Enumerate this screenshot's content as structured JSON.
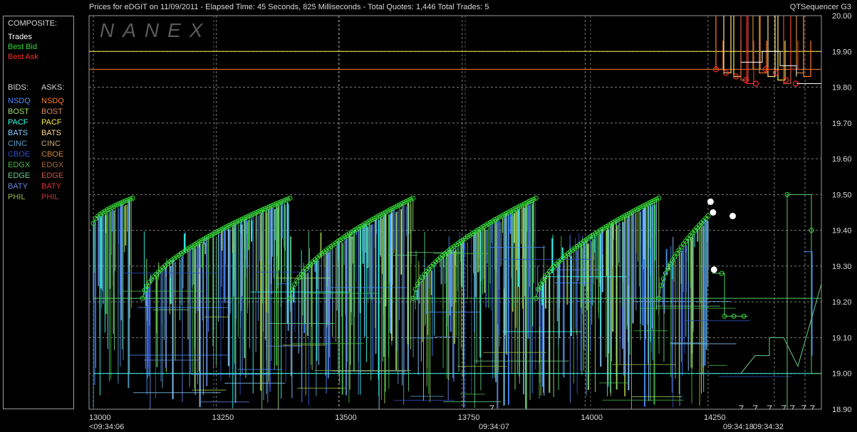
{
  "header": {
    "title": "Prices for  eDGIT  on  11/09/2011  -  Elapsed Time: 45 Seconds, 825 Milliseconds  -  Total Quotes: 1,446  Total Trades: 5",
    "app_name": "QTSequencer G3"
  },
  "watermark": "NANEX",
  "legend": {
    "composite_heading": "COMPOSITE:",
    "composite": [
      {
        "label": "Trades",
        "color": "#ffffff"
      },
      {
        "label": "Best Bid",
        "color": "#33dd33"
      },
      {
        "label": "Best Ask",
        "color": "#ff2a2a"
      }
    ],
    "bids_heading": "BIDS:",
    "asks_heading": "ASKS:",
    "bids": [
      {
        "label": "NSDQ",
        "color": "#4a8cff"
      },
      {
        "label": "BOST",
        "color": "#9fe06a"
      },
      {
        "label": "PACF",
        "color": "#33ffee"
      },
      {
        "label": "BATS",
        "color": "#88ccff"
      },
      {
        "label": "CINC",
        "color": "#5aa0c8"
      },
      {
        "label": "CBOE",
        "color": "#3050c0"
      },
      {
        "label": "EDGX",
        "color": "#44bb44"
      },
      {
        "label": "EDGE",
        "color": "#66cc88"
      },
      {
        "label": "BATY",
        "color": "#6688dd"
      },
      {
        "label": "PHIL",
        "color": "#99bb44"
      }
    ],
    "asks": [
      {
        "label": "NSDQ",
        "color": "#ff7a2a"
      },
      {
        "label": "BOST",
        "color": "#e08a5a"
      },
      {
        "label": "PACF",
        "color": "#ffee44"
      },
      {
        "label": "BATS",
        "color": "#ffdd88"
      },
      {
        "label": "CINC",
        "color": "#c8a878"
      },
      {
        "label": "CBOE",
        "color": "#cc8833"
      },
      {
        "label": "EDGX",
        "color": "#aa6633"
      },
      {
        "label": "EDGE",
        "color": "#cc5544"
      },
      {
        "label": "BATY",
        "color": "#dd3333"
      },
      {
        "label": "PHIL",
        "color": "#bb3344"
      }
    ]
  },
  "chart_data": {
    "type": "line",
    "xlim": [
      13000,
      14330
    ],
    "ylim": [
      18.9,
      20.0
    ],
    "x_ticks": [
      13000,
      13250,
      13500,
      13750,
      14000,
      14250
    ],
    "y_ticks": [
      18.9,
      19.0,
      19.1,
      19.2,
      19.3,
      19.4,
      19.5,
      19.6,
      19.7,
      19.8,
      19.9,
      20.0
    ],
    "time_labels": [
      {
        "x": 13000,
        "label": "<09:34:06"
      },
      {
        "x": 13780,
        "label": "09:34:07"
      },
      {
        "x": 14290,
        "label": "09:34:18"
      },
      {
        "x": 14320,
        "label": "09:34:32"
      }
    ],
    "grid": true,
    "trades": [
      [
        14255,
        19.48
      ],
      [
        14260,
        19.45
      ],
      [
        14300,
        19.44
      ],
      [
        14262,
        19.29
      ]
    ],
    "best_bid_sawtooth_cycles": [
      {
        "start": [
          13000,
          19.42
        ],
        "end": [
          13080,
          19.49
        ]
      },
      {
        "start": [
          13100,
          19.21
        ],
        "end": [
          13400,
          19.49
        ]
      },
      {
        "start": [
          13400,
          19.21
        ],
        "end": [
          13650,
          19.49
        ]
      },
      {
        "start": [
          13650,
          19.21
        ],
        "end": [
          13900,
          19.49
        ]
      },
      {
        "start": [
          13900,
          19.21
        ],
        "end": [
          14150,
          19.49
        ]
      },
      {
        "start": [
          14150,
          19.21
        ],
        "end": [
          14250,
          19.44
        ]
      }
    ],
    "best_ask_levels": [
      19.85,
      19.84,
      19.83,
      19.82,
      19.81
    ],
    "ask_reference_lines": [
      {
        "price": 19.9,
        "color": "#ffee44"
      },
      {
        "price": 19.85,
        "color": "#ff7a2a"
      },
      {
        "price": 19.81,
        "color": "#ffffff"
      }
    ]
  }
}
